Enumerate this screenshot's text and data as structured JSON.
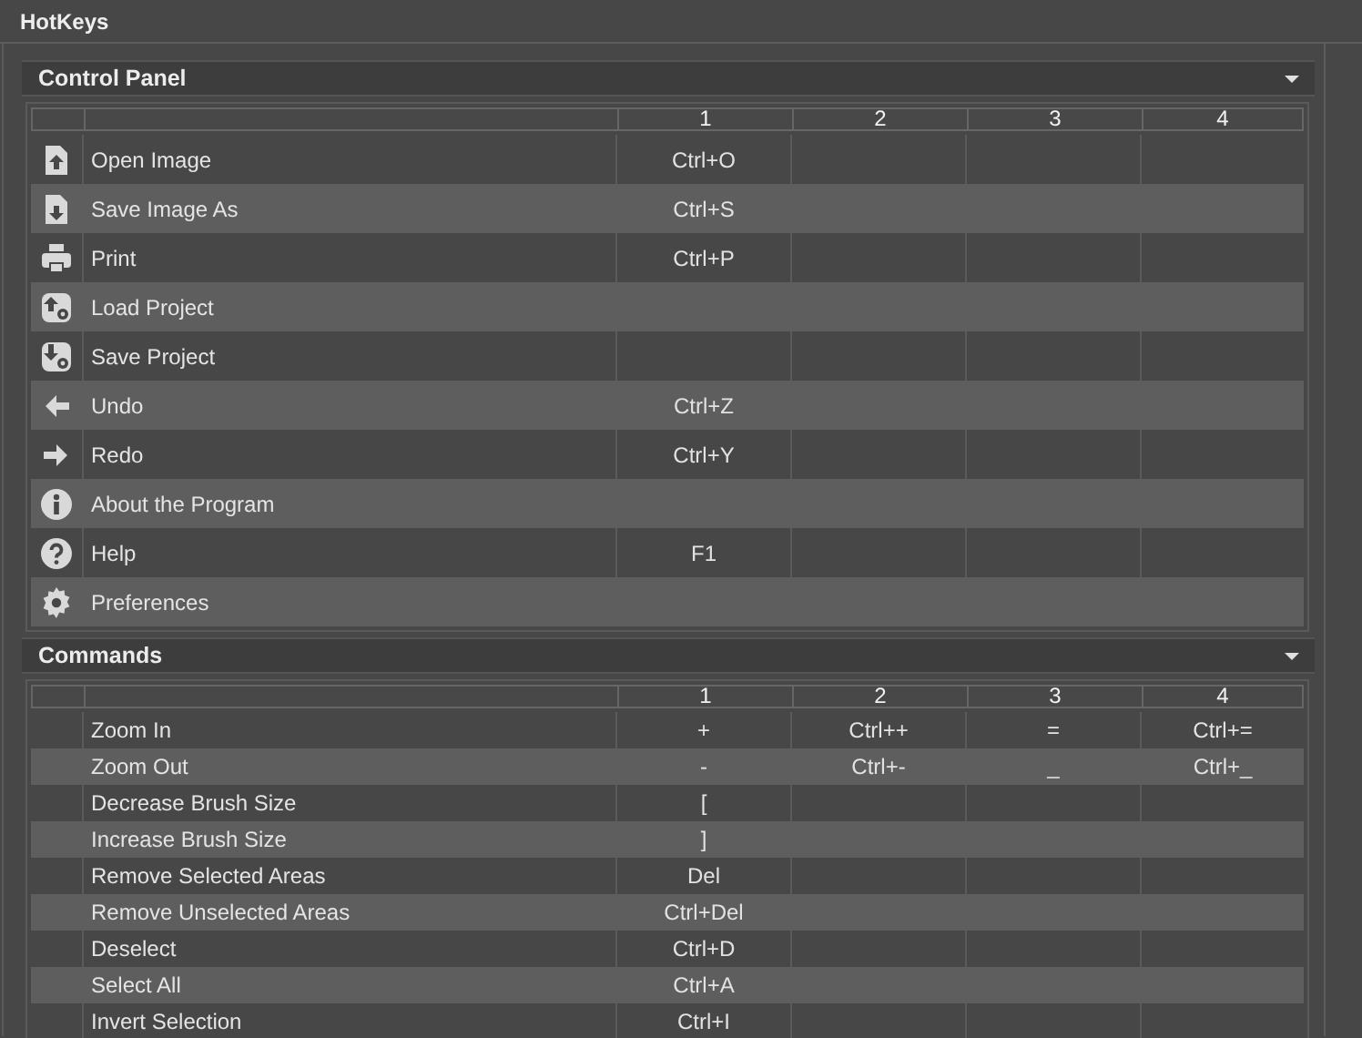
{
  "window": {
    "title": "HotKeys"
  },
  "sections": [
    {
      "title": "Control Panel",
      "expanded": true,
      "kind": "icons",
      "columns": [
        "1",
        "2",
        "3",
        "4"
      ],
      "rows": [
        {
          "name": "Open Image",
          "keys": [
            "Ctrl+O"
          ]
        },
        {
          "name": "Save Image As",
          "keys": [
            "Ctrl+S"
          ]
        },
        {
          "name": "Print",
          "keys": [
            "Ctrl+P"
          ]
        },
        {
          "name": "Load Project",
          "keys": []
        },
        {
          "name": "Save Project",
          "keys": []
        },
        {
          "name": "Undo",
          "keys": [
            "Ctrl+Z"
          ]
        },
        {
          "name": "Redo",
          "keys": [
            "Ctrl+Y"
          ]
        },
        {
          "name": "About the Program",
          "keys": []
        },
        {
          "name": "Help",
          "keys": [
            "F1"
          ]
        },
        {
          "name": "Preferences",
          "keys": []
        }
      ]
    },
    {
      "title": "Commands",
      "expanded": true,
      "kind": "plain",
      "columns": [
        "1",
        "2",
        "3",
        "4"
      ],
      "rows": [
        {
          "name": "Zoom In",
          "keys": [
            "+",
            "Ctrl++",
            "=",
            "Ctrl+="
          ]
        },
        {
          "name": "Zoom Out",
          "keys": [
            "-",
            "Ctrl+-",
            "_",
            "Ctrl+_"
          ]
        },
        {
          "name": "Decrease Brush Size",
          "keys": [
            "["
          ]
        },
        {
          "name": "Increase Brush Size",
          "keys": [
            "]"
          ]
        },
        {
          "name": "Remove Selected Areas",
          "keys": [
            "Del"
          ]
        },
        {
          "name": "Remove Unselected Areas",
          "keys": [
            "Ctrl+Del"
          ]
        },
        {
          "name": "Deselect",
          "keys": [
            "Ctrl+D"
          ]
        },
        {
          "name": "Select All",
          "keys": [
            "Ctrl+A"
          ]
        },
        {
          "name": "Invert Selection",
          "keys": [
            "Ctrl+I"
          ]
        }
      ]
    }
  ]
}
